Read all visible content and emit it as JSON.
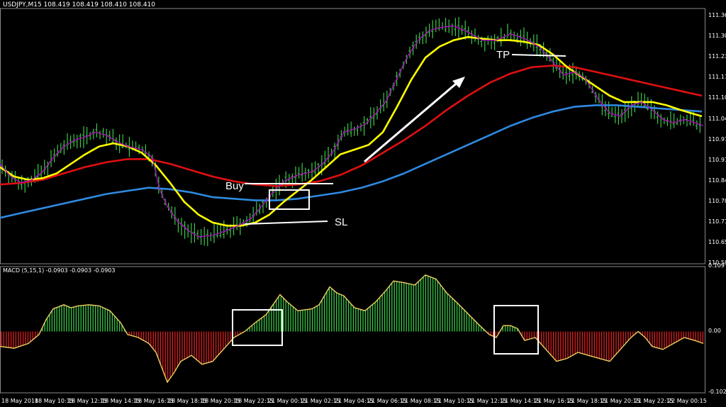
{
  "chart_data": {
    "type": "line",
    "main": {
      "title": "USDJPY,M15  108.419 108.419 108.410 108.410",
      "ylim": [
        110.585,
        111.39
      ],
      "y_ticks": [
        "111.365",
        "111.300",
        "111.235",
        "111.170",
        "111.105",
        "111.040",
        "110.975",
        "110.910",
        "110.845",
        "110.780",
        "110.715",
        "110.650",
        "110.585"
      ],
      "series": [
        {
          "color": "#ffff00",
          "points": [
            [
              0,
              110.89
            ],
            [
              20,
              110.86
            ],
            [
              40,
              110.85
            ],
            [
              60,
              110.855
            ],
            [
              80,
              110.87
            ],
            [
              100,
              110.9
            ],
            [
              120,
              110.93
            ],
            [
              140,
              110.955
            ],
            [
              160,
              110.965
            ],
            [
              180,
              110.955
            ],
            [
              200,
              110.935
            ],
            [
              220,
              110.895
            ],
            [
              240,
              110.84
            ],
            [
              260,
              110.78
            ],
            [
              280,
              110.74
            ],
            [
              300,
              110.715
            ],
            [
              320,
              110.705
            ],
            [
              340,
              110.705
            ],
            [
              360,
              110.715
            ],
            [
              380,
              110.74
            ],
            [
              400,
              110.78
            ],
            [
              420,
              110.815
            ],
            [
              440,
              110.85
            ],
            [
              460,
              110.89
            ],
            [
              480,
              110.93
            ],
            [
              500,
              110.945
            ],
            [
              520,
              110.96
            ],
            [
              540,
              111.0
            ],
            [
              560,
              111.08
            ],
            [
              580,
              111.165
            ],
            [
              600,
              111.235
            ],
            [
              620,
              111.27
            ],
            [
              640,
              111.29
            ],
            [
              660,
              111.3
            ],
            [
              680,
              111.295
            ],
            [
              700,
              111.29
            ],
            [
              720,
              111.29
            ],
            [
              740,
              111.285
            ],
            [
              760,
              111.275
            ],
            [
              780,
              111.245
            ],
            [
              800,
              111.205
            ],
            [
              820,
              111.175
            ],
            [
              840,
              111.145
            ],
            [
              860,
              111.115
            ],
            [
              880,
              111.095
            ],
            [
              900,
              111.095
            ],
            [
              920,
              111.095
            ],
            [
              940,
              111.085
            ],
            [
              960,
              111.07
            ],
            [
              975,
              111.06
            ],
            [
              990,
              111.05
            ]
          ]
        },
        {
          "color": "#e01010",
          "points": [
            [
              0,
              110.835
            ],
            [
              30,
              110.84
            ],
            [
              60,
              110.85
            ],
            [
              90,
              110.87
            ],
            [
              120,
              110.89
            ],
            [
              150,
              110.905
            ],
            [
              180,
              110.915
            ],
            [
              210,
              110.915
            ],
            [
              240,
              110.9
            ],
            [
              270,
              110.88
            ],
            [
              300,
              110.86
            ],
            [
              330,
              110.845
            ],
            [
              360,
              110.835
            ],
            [
              390,
              110.83
            ],
            [
              420,
              110.835
            ],
            [
              450,
              110.845
            ],
            [
              480,
              110.865
            ],
            [
              510,
              110.895
            ],
            [
              540,
              110.935
            ],
            [
              570,
              110.975
            ],
            [
              600,
              111.02
            ],
            [
              630,
              111.07
            ],
            [
              660,
              111.115
            ],
            [
              690,
              111.155
            ],
            [
              720,
              111.185
            ],
            [
              750,
              111.205
            ],
            [
              780,
              111.21
            ],
            [
              810,
              111.205
            ],
            [
              840,
              111.19
            ],
            [
              870,
              111.175
            ],
            [
              900,
              111.16
            ],
            [
              930,
              111.145
            ],
            [
              960,
              111.13
            ],
            [
              990,
              111.115
            ]
          ]
        },
        {
          "color": "#2f8ae0",
          "points": [
            [
              0,
              110.73
            ],
            [
              30,
              110.745
            ],
            [
              60,
              110.76
            ],
            [
              90,
              110.775
            ],
            [
              120,
              110.79
            ],
            [
              150,
              110.805
            ],
            [
              180,
              110.815
            ],
            [
              210,
              110.825
            ],
            [
              240,
              110.82
            ],
            [
              270,
              110.81
            ],
            [
              300,
              110.795
            ],
            [
              330,
              110.79
            ],
            [
              360,
              110.785
            ],
            [
              390,
              110.785
            ],
            [
              420,
              110.79
            ],
            [
              450,
              110.8
            ],
            [
              480,
              110.81
            ],
            [
              510,
              110.825
            ],
            [
              540,
              110.845
            ],
            [
              570,
              110.87
            ],
            [
              600,
              110.9
            ],
            [
              630,
              110.93
            ],
            [
              660,
              110.96
            ],
            [
              690,
              110.99
            ],
            [
              720,
              111.02
            ],
            [
              750,
              111.045
            ],
            [
              780,
              111.065
            ],
            [
              810,
              111.08
            ],
            [
              840,
              111.085
            ],
            [
              870,
              111.085
            ],
            [
              900,
              111.08
            ],
            [
              930,
              111.075
            ],
            [
              960,
              111.07
            ],
            [
              990,
              111.065
            ]
          ]
        },
        {
          "color": "#b000c0",
          "points": [
            [
              0,
              110.9
            ],
            [
              15,
              110.86
            ],
            [
              30,
              110.84
            ],
            [
              45,
              110.85
            ],
            [
              60,
              110.875
            ],
            [
              75,
              110.92
            ],
            [
              90,
              110.955
            ],
            [
              105,
              110.975
            ],
            [
              120,
              110.985
            ],
            [
              135,
              111.0
            ],
            [
              150,
              110.99
            ],
            [
              165,
              110.97
            ],
            [
              180,
              110.955
            ],
            [
              200,
              110.945
            ],
            [
              215,
              110.92
            ],
            [
              225,
              110.82
            ],
            [
              235,
              110.77
            ],
            [
              250,
              110.72
            ],
            [
              265,
              110.69
            ],
            [
              280,
              110.67
            ],
            [
              300,
              110.675
            ],
            [
              320,
              110.69
            ],
            [
              340,
              110.71
            ],
            [
              355,
              110.73
            ],
            [
              370,
              110.77
            ],
            [
              385,
              110.81
            ],
            [
              400,
              110.845
            ],
            [
              420,
              110.865
            ],
            [
              440,
              110.875
            ],
            [
              455,
              110.9
            ],
            [
              470,
              110.94
            ],
            [
              485,
              111.0
            ],
            [
              500,
              111.01
            ],
            [
              515,
              111.025
            ],
            [
              530,
              111.06
            ],
            [
              545,
              111.1
            ],
            [
              560,
              111.17
            ],
            [
              575,
              111.24
            ],
            [
              590,
              111.29
            ],
            [
              605,
              111.32
            ],
            [
              620,
              111.33
            ],
            [
              640,
              111.335
            ],
            [
              660,
              111.315
            ],
            [
              680,
              111.29
            ],
            [
              700,
              111.29
            ],
            [
              720,
              111.31
            ],
            [
              740,
              111.295
            ],
            [
              760,
              111.27
            ],
            [
              780,
              111.22
            ],
            [
              795,
              111.18
            ],
            [
              810,
              111.19
            ],
            [
              825,
              111.17
            ],
            [
              845,
              111.1
            ],
            [
              860,
              111.06
            ],
            [
              875,
              111.05
            ],
            [
              890,
              111.085
            ],
            [
              905,
              111.095
            ],
            [
              920,
              111.07
            ],
            [
              935,
              111.04
            ],
            [
              950,
              111.03
            ],
            [
              965,
              111.04
            ],
            [
              980,
              111.03
            ],
            [
              992,
              111.02
            ]
          ]
        }
      ],
      "annotations": {
        "buy": "Buy",
        "sl": "SL",
        "tp": "TP"
      }
    },
    "macd": {
      "title": "MACD (5,15,1) -0.0903 -0.0903 -0.0903",
      "ylim": [
        -0.1029,
        0.109
      ],
      "y_ticks": [
        "0.109",
        "0.00",
        "-0.1029"
      ],
      "values": [
        [
          0,
          -0.025
        ],
        [
          20,
          -0.028
        ],
        [
          40,
          -0.02
        ],
        [
          55,
          -0.005
        ],
        [
          65,
          0.02
        ],
        [
          75,
          0.038
        ],
        [
          90,
          0.045
        ],
        [
          100,
          0.04
        ],
        [
          110,
          0.043
        ],
        [
          125,
          0.045
        ],
        [
          140,
          0.043
        ],
        [
          155,
          0.035
        ],
        [
          170,
          0.015
        ],
        [
          180,
          -0.005
        ],
        [
          195,
          -0.01
        ],
        [
          210,
          -0.02
        ],
        [
          220,
          -0.035
        ],
        [
          228,
          -0.06
        ],
        [
          236,
          -0.085
        ],
        [
          245,
          -0.07
        ],
        [
          255,
          -0.05
        ],
        [
          270,
          -0.04
        ],
        [
          285,
          -0.055
        ],
        [
          300,
          -0.05
        ],
        [
          315,
          -0.03
        ],
        [
          330,
          -0.01
        ],
        [
          345,
          0.0
        ],
        [
          360,
          0.015
        ],
        [
          375,
          0.028
        ],
        [
          385,
          0.045
        ],
        [
          395,
          0.062
        ],
        [
          405,
          0.05
        ],
        [
          420,
          0.035
        ],
        [
          440,
          0.038
        ],
        [
          450,
          0.045
        ],
        [
          465,
          0.075
        ],
        [
          475,
          0.065
        ],
        [
          485,
          0.06
        ],
        [
          500,
          0.04
        ],
        [
          515,
          0.035
        ],
        [
          530,
          0.05
        ],
        [
          545,
          0.07
        ],
        [
          555,
          0.085
        ],
        [
          570,
          0.082
        ],
        [
          585,
          0.078
        ],
        [
          600,
          0.095
        ],
        [
          615,
          0.088
        ],
        [
          630,
          0.065
        ],
        [
          645,
          0.048
        ],
        [
          660,
          0.03
        ],
        [
          675,
          0.012
        ],
        [
          690,
          -0.005
        ],
        [
          700,
          -0.01
        ],
        [
          710,
          0.01
        ],
        [
          720,
          0.01
        ],
        [
          730,
          0.005
        ],
        [
          740,
          -0.015
        ],
        [
          755,
          -0.01
        ],
        [
          770,
          -0.03
        ],
        [
          785,
          -0.05
        ],
        [
          800,
          -0.045
        ],
        [
          815,
          -0.035
        ],
        [
          830,
          -0.04
        ],
        [
          845,
          -0.045
        ],
        [
          860,
          -0.05
        ],
        [
          875,
          -0.03
        ],
        [
          890,
          -0.01
        ],
        [
          900,
          0.0
        ],
        [
          910,
          -0.01
        ],
        [
          920,
          -0.025
        ],
        [
          935,
          -0.03
        ],
        [
          950,
          -0.02
        ],
        [
          965,
          -0.01
        ],
        [
          980,
          -0.015
        ],
        [
          992,
          -0.02
        ]
      ]
    },
    "x_ticks": [
      "18 May 2018",
      "18 May 10:15",
      "18 May 12:15",
      "18 May 14:15",
      "18 May 16:15",
      "18 May 18:15",
      "18 May 20:15",
      "18 May 22:15",
      "21 May 00:15",
      "21 May 02:15",
      "21 May 04:15",
      "21 May 06:15",
      "21 May 08:15",
      "21 May 10:15",
      "21 May 12:15",
      "21 May 14:15",
      "21 May 16:15",
      "21 May 18:15",
      "21 May 20:15",
      "21 May 22:15",
      "22 May 00:15"
    ]
  }
}
